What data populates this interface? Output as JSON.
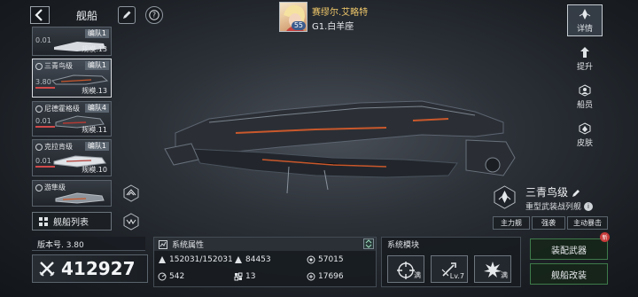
{
  "header": {
    "title": "舰船",
    "back_icon": "chevron-left-icon",
    "edit_icon": "pencil-icon",
    "help_icon": "question-icon"
  },
  "captain": {
    "name": "赛缪尔.艾略特",
    "subtitle": "G1.白羊座",
    "level": "55"
  },
  "ship_list": [
    {
      "name": "",
      "badge": "编队1",
      "value": "0.01",
      "scale": "规模.13",
      "selected": false
    },
    {
      "name": "三青鸟级",
      "badge": "编队1",
      "value": "3.80",
      "scale": "规模.13",
      "selected": true
    },
    {
      "name": "尼德霍格级",
      "badge": "编队4",
      "value": "0.01",
      "scale": "规模.11",
      "selected": false
    },
    {
      "name": "克拉肯级",
      "badge": "编队1",
      "value": "0.01",
      "scale": "规模.10",
      "selected": false
    },
    {
      "name": "游隼级",
      "badge": "",
      "value": "",
      "scale": "",
      "selected": false
    }
  ],
  "fleet_list_label": "舰船列表",
  "version": "版本号. 3.80",
  "power": "412927",
  "attributes": {
    "title": "系统属性",
    "items": [
      {
        "icon": "hull-icon",
        "value": "152031/152031"
      },
      {
        "icon": "damage-icon",
        "value": "84453"
      },
      {
        "icon": "shield-icon",
        "value": "57015"
      },
      {
        "icon": "speed-icon",
        "value": "542"
      },
      {
        "icon": "grid-icon",
        "value": "13"
      },
      {
        "icon": "energy-icon",
        "value": "17696"
      }
    ]
  },
  "modules": {
    "title": "系统模块",
    "items": [
      {
        "icon": "crosshair-icon",
        "tag": "满"
      },
      {
        "icon": "missile-icon",
        "tag": "Lv.7"
      },
      {
        "icon": "explosion-icon",
        "tag": "满"
      }
    ]
  },
  "actions": {
    "equip": "装配武器",
    "refit": "舰船改装",
    "new_badge": "新"
  },
  "ship_info": {
    "class_name": "三青鸟级",
    "type": "重型武装战列舰",
    "tags": [
      "主力舰",
      "强袭",
      "主动暴击"
    ]
  },
  "nav": [
    {
      "label": "详情",
      "icon": "detail-icon",
      "active": true
    },
    {
      "label": "提升",
      "icon": "upgrade-icon",
      "active": false
    },
    {
      "label": "船员",
      "icon": "crew-icon",
      "active": false
    },
    {
      "label": "皮肤",
      "icon": "skin-icon",
      "active": false
    }
  ],
  "colors": {
    "accent_red": "#d04a4a",
    "accent_green": "#3f7a4a",
    "captain_name": "#f0c86a"
  }
}
